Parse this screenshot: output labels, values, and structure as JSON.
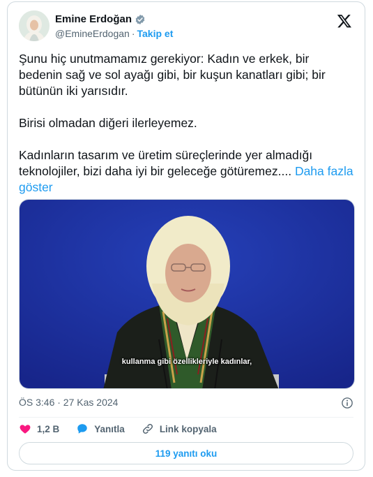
{
  "author": {
    "name": "Emine Erdoğan",
    "handle": "@EmineErdogan",
    "separator": "·",
    "follow_label": "Takip et"
  },
  "tweet": {
    "paragraphs": [
      "Şunu hiç unutmamamız gerekiyor: Kadın ve erkek, bir bedenin sağ ve sol ayağı gibi, bir kuşun kanatları gibi; bir bütünün iki yarısıdır.",
      "Birisi olmadan diğeri ilerleyemez.",
      "Kadınların tasarım ve üretim süreçlerinde yer almadığı teknolojiler, bizi daha iyi bir geleceğe götüremez...."
    ],
    "show_more_label": "Daha fazla göster"
  },
  "media": {
    "caption": "kullanma gibi özellikleriyle kadınlar,",
    "background_color": "#1b2f9a"
  },
  "timestamp": "ÖS 3:46 · 27 Kas 2024",
  "actions": {
    "like_count": "1,2 B",
    "reply_label": "Yanıtla",
    "copy_link_label": "Link kopyala"
  },
  "replies_button_label": "119 yanıtı oku",
  "colors": {
    "accent": "#1d9bf0",
    "like": "#f91880",
    "muted": "#536471"
  },
  "icons": [
    "verified-badge-icon",
    "x-logo-icon",
    "info-icon",
    "heart-icon",
    "reply-bubble-icon",
    "link-icon"
  ]
}
